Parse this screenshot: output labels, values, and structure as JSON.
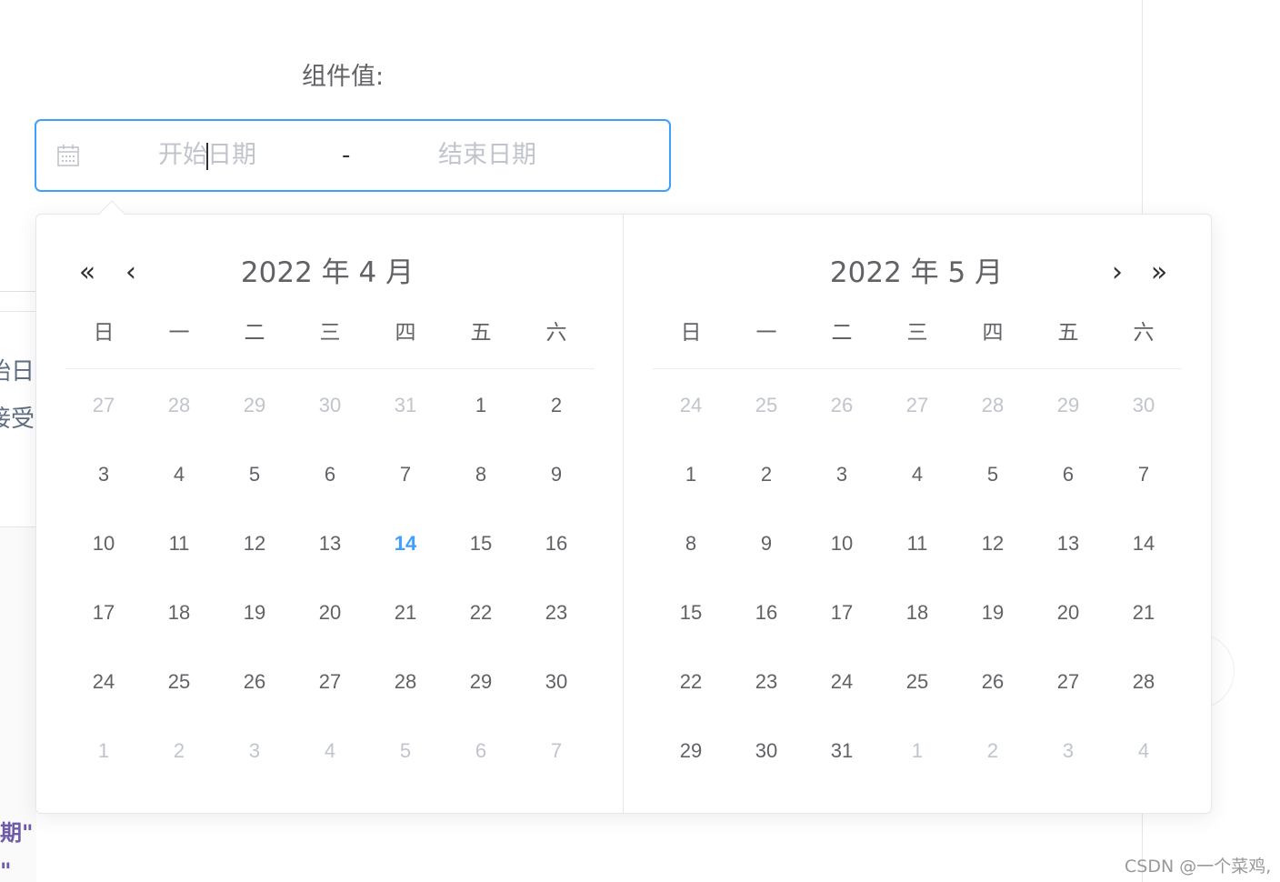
{
  "form": {
    "label": "组件值:"
  },
  "date_range": {
    "start_placeholder": "开始日期",
    "separator": "-",
    "end_placeholder": "结束日期",
    "focused": "start",
    "accent_color": "#409eff"
  },
  "background_fragments": {
    "text_1": "始日",
    "text_2": "接受",
    "code_1": "期\"",
    "code_2": "\""
  },
  "picker": {
    "left_panel": {
      "title": "2022 年 4 月",
      "nav_prev_year": "«",
      "nav_prev_month": "‹"
    },
    "right_panel": {
      "title": "2022 年 5 月",
      "nav_next_month": "›",
      "nav_next_year": "»"
    },
    "weekdays": [
      "日",
      "一",
      "二",
      "三",
      "四",
      "五",
      "六"
    ],
    "months": [
      {
        "weeks": [
          [
            [
              "27",
              "prev"
            ],
            [
              "28",
              "prev"
            ],
            [
              "29",
              "prev"
            ],
            [
              "30",
              "prev"
            ],
            [
              "31",
              "prev"
            ],
            [
              "1",
              "cur"
            ],
            [
              "2",
              "cur"
            ]
          ],
          [
            [
              "3",
              "cur"
            ],
            [
              "4",
              "cur"
            ],
            [
              "5",
              "cur"
            ],
            [
              "6",
              "cur"
            ],
            [
              "7",
              "cur"
            ],
            [
              "8",
              "cur"
            ],
            [
              "9",
              "cur"
            ]
          ],
          [
            [
              "10",
              "cur"
            ],
            [
              "11",
              "cur"
            ],
            [
              "12",
              "cur"
            ],
            [
              "13",
              "cur"
            ],
            [
              "14",
              "today"
            ],
            [
              "15",
              "cur"
            ],
            [
              "16",
              "cur"
            ]
          ],
          [
            [
              "17",
              "cur"
            ],
            [
              "18",
              "cur"
            ],
            [
              "19",
              "cur"
            ],
            [
              "20",
              "cur"
            ],
            [
              "21",
              "cur"
            ],
            [
              "22",
              "cur"
            ],
            [
              "23",
              "cur"
            ]
          ],
          [
            [
              "24",
              "cur"
            ],
            [
              "25",
              "cur"
            ],
            [
              "26",
              "cur"
            ],
            [
              "27",
              "cur"
            ],
            [
              "28",
              "cur"
            ],
            [
              "29",
              "cur"
            ],
            [
              "30",
              "cur"
            ]
          ],
          [
            [
              "1",
              "next"
            ],
            [
              "2",
              "next"
            ],
            [
              "3",
              "next"
            ],
            [
              "4",
              "next"
            ],
            [
              "5",
              "next"
            ],
            [
              "6",
              "next"
            ],
            [
              "7",
              "next"
            ]
          ]
        ]
      },
      {
        "weeks": [
          [
            [
              "24",
              "prev"
            ],
            [
              "25",
              "prev"
            ],
            [
              "26",
              "prev"
            ],
            [
              "27",
              "prev"
            ],
            [
              "28",
              "prev"
            ],
            [
              "29",
              "prev"
            ],
            [
              "30",
              "prev"
            ]
          ],
          [
            [
              "1",
              "cur"
            ],
            [
              "2",
              "cur"
            ],
            [
              "3",
              "cur"
            ],
            [
              "4",
              "cur"
            ],
            [
              "5",
              "cur"
            ],
            [
              "6",
              "cur"
            ],
            [
              "7",
              "cur"
            ]
          ],
          [
            [
              "8",
              "cur"
            ],
            [
              "9",
              "cur"
            ],
            [
              "10",
              "cur"
            ],
            [
              "11",
              "cur"
            ],
            [
              "12",
              "cur"
            ],
            [
              "13",
              "cur"
            ],
            [
              "14",
              "cur"
            ]
          ],
          [
            [
              "15",
              "cur"
            ],
            [
              "16",
              "cur"
            ],
            [
              "17",
              "cur"
            ],
            [
              "18",
              "cur"
            ],
            [
              "19",
              "cur"
            ],
            [
              "20",
              "cur"
            ],
            [
              "21",
              "cur"
            ]
          ],
          [
            [
              "22",
              "cur"
            ],
            [
              "23",
              "cur"
            ],
            [
              "24",
              "cur"
            ],
            [
              "25",
              "cur"
            ],
            [
              "26",
              "cur"
            ],
            [
              "27",
              "cur"
            ],
            [
              "28",
              "cur"
            ]
          ],
          [
            [
              "29",
              "cur"
            ],
            [
              "30",
              "cur"
            ],
            [
              "31",
              "cur"
            ],
            [
              "1",
              "next"
            ],
            [
              "2",
              "next"
            ],
            [
              "3",
              "next"
            ],
            [
              "4",
              "next"
            ]
          ]
        ]
      }
    ]
  },
  "watermark": "CSDN @一个菜鸡,"
}
